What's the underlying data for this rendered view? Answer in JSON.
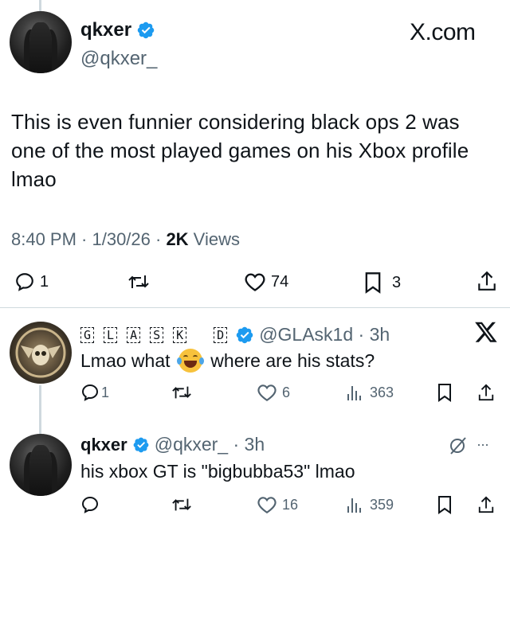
{
  "main_tweet": {
    "display_name": "qkxer",
    "handle": "@qkxer_",
    "brand": "X.com",
    "text": "This is even funnier considering black ops 2 was one of the most played games on his Xbox profile lmao",
    "time": "8:40 PM · 1/30/26 · ",
    "views_count": "2K",
    "views_label": " Views",
    "replies": "1",
    "likes": "74",
    "bookmarks": "3"
  },
  "reply1": {
    "display_name_letters": [
      "G",
      "L",
      "A",
      "S",
      "K",
      "D"
    ],
    "handle_time": "@GLAsk1d · 3h",
    "text_before": "Lmao what ",
    "emoji": "😂",
    "text_after": " where are his stats?",
    "replies": "1",
    "likes": "6",
    "views": "363"
  },
  "reply2": {
    "display_name": "qkxer",
    "handle_time": "@qkxer_ · 3h",
    "more": "···",
    "text": "his xbox GT is \"bigbubba53\" lmao",
    "likes": "16",
    "views": "359"
  },
  "colors": {
    "verified": "#1d9bf0",
    "secondary_text": "#536471",
    "primary_text": "#0f1419",
    "emoji": "#f7c23c"
  }
}
